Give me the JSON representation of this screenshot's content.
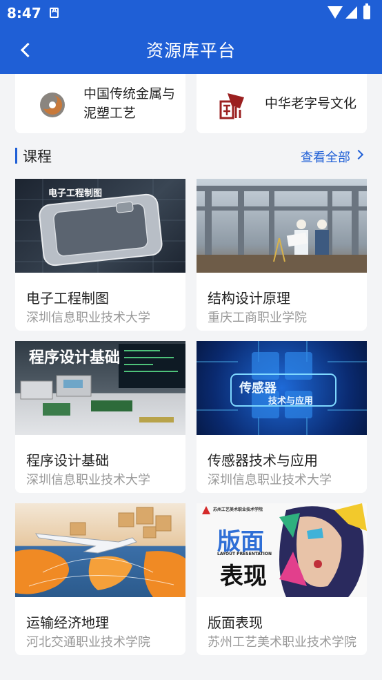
{
  "status_bar": {
    "time": "8:47"
  },
  "header": {
    "title": "资源库平台"
  },
  "categories": [
    {
      "name": "中国传统金属与泥塑工艺",
      "icon": "metal-craft-logo-icon"
    },
    {
      "name": "中华老字号文化",
      "icon": "time-honored-brand-logo-icon"
    }
  ],
  "courses_section": {
    "title": "课程",
    "view_all": "查看全部"
  },
  "courses": [
    {
      "title": "电子工程制图",
      "school": "深圳信息职业技术大学",
      "thumb_text": "电子工程制图"
    },
    {
      "title": "结构设计原理",
      "school": "重庆工商职业学院",
      "thumb_text": ""
    },
    {
      "title": "程序设计基础",
      "school": "深圳信息职业技术大学",
      "thumb_text": "程序设计基础"
    },
    {
      "title": "传感器技术与应用",
      "school": "深圳信息职业技术大学",
      "thumb_text_1": "传感器",
      "thumb_text_2": "技术与应用"
    },
    {
      "title": "运输经济地理",
      "school": "河北交通职业技术学院",
      "thumb_text": ""
    },
    {
      "title": "版面表现",
      "school": "苏州工艺美术职业技术学院",
      "thumb_text_1": "版面",
      "thumb_text_2": "表现",
      "thumb_text_3": "LAYOUT PRESENTATION",
      "thumb_text_4": "苏州工艺美术职业技术学院"
    }
  ],
  "colors": {
    "primary": "#1f5fd6",
    "background": "#f3f4f6"
  }
}
